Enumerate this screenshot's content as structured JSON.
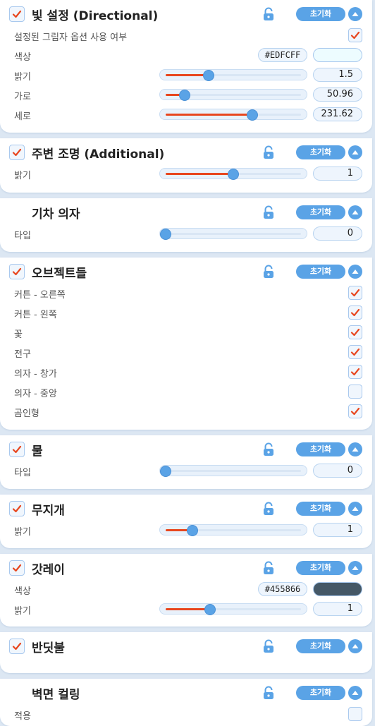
{
  "common": {
    "reset_label": "초기화",
    "lock_icon": "unlock-icon",
    "collapse_icon": "chevron-up-icon",
    "check_icon": "checkmark-icon",
    "accent_color": "#5aa3e6",
    "slider_fill_color": "#e8461e"
  },
  "panels": [
    {
      "title": "빛 설정 (Directional)",
      "enabled": true,
      "rows": [
        {
          "label": "설정된 그림자 옵션 사용 여부",
          "type": "checkbox",
          "checked": true
        },
        {
          "label": "색상",
          "type": "color",
          "hex": "#EDFCFF",
          "color": "#EDFCFF"
        },
        {
          "label": "밝기",
          "type": "slider",
          "fraction": 0.32,
          "value": "1.5"
        },
        {
          "label": "가로",
          "type": "slider",
          "fraction": 0.14,
          "value": "50.96"
        },
        {
          "label": "세로",
          "type": "slider",
          "fraction": 0.64,
          "value": "231.62"
        }
      ]
    },
    {
      "title": "주변 조명 (Additional)",
      "enabled": true,
      "rows": [
        {
          "label": "밝기",
          "type": "slider",
          "fraction": 0.5,
          "value": "1"
        }
      ]
    },
    {
      "title": "기차 의자",
      "enabled": null,
      "rows": [
        {
          "label": "타입",
          "type": "slider",
          "fraction": 0.0,
          "value": "0"
        }
      ]
    },
    {
      "title": "오브젝트들",
      "enabled": true,
      "rows": [
        {
          "label": "커튼 - 오른쪽",
          "type": "checkbox",
          "checked": true
        },
        {
          "label": "커튼 - 왼쪽",
          "type": "checkbox",
          "checked": true
        },
        {
          "label": "꽃",
          "type": "checkbox",
          "checked": true
        },
        {
          "label": "전구",
          "type": "checkbox",
          "checked": true
        },
        {
          "label": "의자 - 창가",
          "type": "checkbox",
          "checked": true
        },
        {
          "label": "의자 - 중앙",
          "type": "checkbox",
          "checked": false
        },
        {
          "label": "곰인형",
          "type": "checkbox",
          "checked": true
        }
      ]
    },
    {
      "title": "물",
      "enabled": true,
      "rows": [
        {
          "label": "타입",
          "type": "slider",
          "fraction": 0.0,
          "value": "0"
        }
      ]
    },
    {
      "title": "무지개",
      "enabled": true,
      "rows": [
        {
          "label": "밝기",
          "type": "slider",
          "fraction": 0.2,
          "value": "1"
        }
      ]
    },
    {
      "title": "갓레이",
      "enabled": true,
      "rows": [
        {
          "label": "색상",
          "type": "color",
          "hex": "#455866",
          "color": "#455866"
        },
        {
          "label": "밝기",
          "type": "slider",
          "fraction": 0.33,
          "value": "1"
        }
      ]
    },
    {
      "title": "반딧불",
      "enabled": true,
      "rows": []
    },
    {
      "title": "벽면 컬링",
      "enabled": null,
      "rows": [
        {
          "label": "적용",
          "type": "checkbox",
          "checked": false
        }
      ]
    }
  ]
}
